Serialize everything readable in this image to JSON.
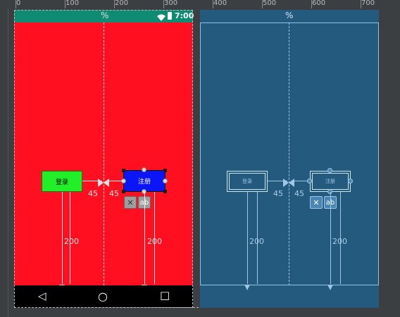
{
  "ruler": {
    "ticks": [
      "0",
      "100",
      "200",
      "300",
      "400",
      "500",
      "600",
      "700"
    ]
  },
  "statusbar": {
    "time": "7:00",
    "percent_marker": "%"
  },
  "design": {
    "login_label": "登录",
    "register_label": "注册",
    "margin_left": "45",
    "margin_right": "45",
    "margin_bottom_left": "200",
    "margin_bottom_right": "200",
    "clear_constraints_glyph": "✕",
    "baseline_glyph": "ab"
  },
  "blueprint": {
    "percent_marker": "%",
    "login_label": "登录",
    "register_label": "注册",
    "margin_left": "45",
    "margin_right": "45",
    "margin_bottom_left": "200",
    "margin_bottom_right": "200",
    "clear_constraints_glyph": "✕",
    "baseline_glyph": "ab"
  },
  "navbar": {
    "back": "◁",
    "home": "○",
    "recents": "□"
  },
  "colors": {
    "canvas": "#ff0f1f",
    "login": "#22ee2a",
    "register": "#0a16f5",
    "blueprint": "#255a7f",
    "statusbar": "#0f8b74"
  }
}
